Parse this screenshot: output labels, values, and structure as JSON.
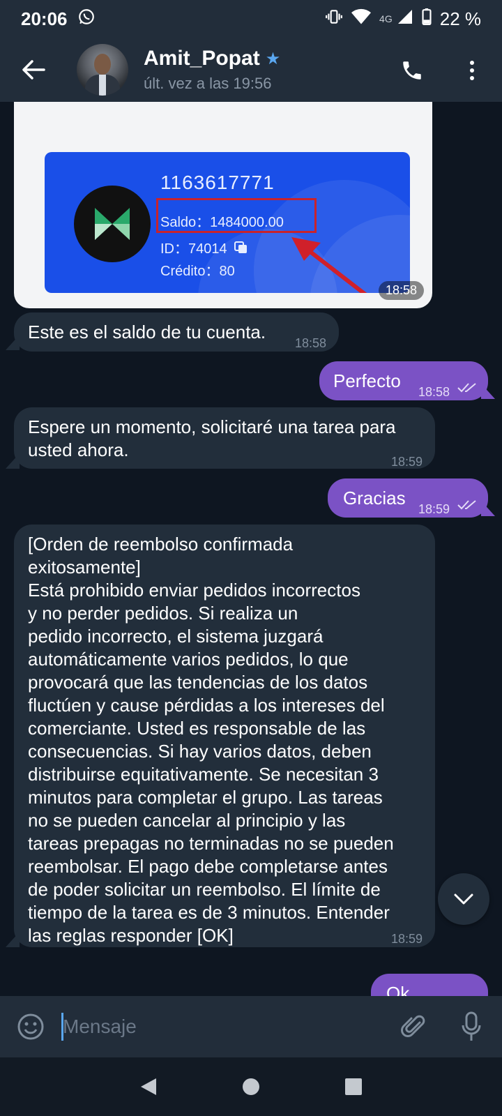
{
  "status_bar": {
    "time": "20:06",
    "network": "4G",
    "battery": "22 %"
  },
  "header": {
    "contact_name": "Amit_Popat",
    "last_seen": "últ. vez a las 19:56"
  },
  "image_message": {
    "account": "1163617771",
    "saldo": "Saldo：1484000.00",
    "id": "ID：74014",
    "credito": "Crédito：80",
    "time": "18:58"
  },
  "messages": [
    {
      "direction": "in",
      "text": "Este es el saldo de tu cuenta.",
      "time": "18:58"
    },
    {
      "direction": "out",
      "text": "Perfecto",
      "time": "18:58"
    },
    {
      "direction": "in",
      "line1": "Espere un momento, solicitaré una tarea para",
      "line2": "usted ahora.",
      "time": "18:59"
    },
    {
      "direction": "out",
      "text": "Gracias",
      "time": "18:59"
    },
    {
      "direction": "in",
      "lines": [
        "[Orden de reembolso confirmada",
        "exitosamente]",
        "Está prohibido enviar pedidos incorrectos",
        "y no perder pedidos. Si realiza un",
        "pedido incorrecto, el sistema juzgará",
        "automáticamente varios pedidos, lo que",
        "provocará que las tendencias de los datos",
        "fluctúen y cause pérdidas a los intereses del",
        "comerciante. Usted es responsable de las",
        "consecuencias. Si hay varios datos, deben",
        "distribuirse equitativamente. Se necesitan 3",
        "minutos para completar el grupo. Las tareas",
        "no se pueden cancelar al principio y las",
        "tareas prepagas no terminadas no se pueden",
        "reembolsar. El pago debe completarse antes",
        "de poder solicitar un reembolso. El límite de",
        "tiempo de la tarea es de 3 minutos. Entender",
        "las reglas responder [OK]"
      ],
      "time": "18:59"
    },
    {
      "direction": "out",
      "text": "Ok"
    }
  ],
  "input": {
    "placeholder": "Mensaje"
  },
  "colors": {
    "accent": "#5aa7f0",
    "outgoing": "#7b52c5",
    "incoming": "#222e3b",
    "background": "#0e1621"
  }
}
